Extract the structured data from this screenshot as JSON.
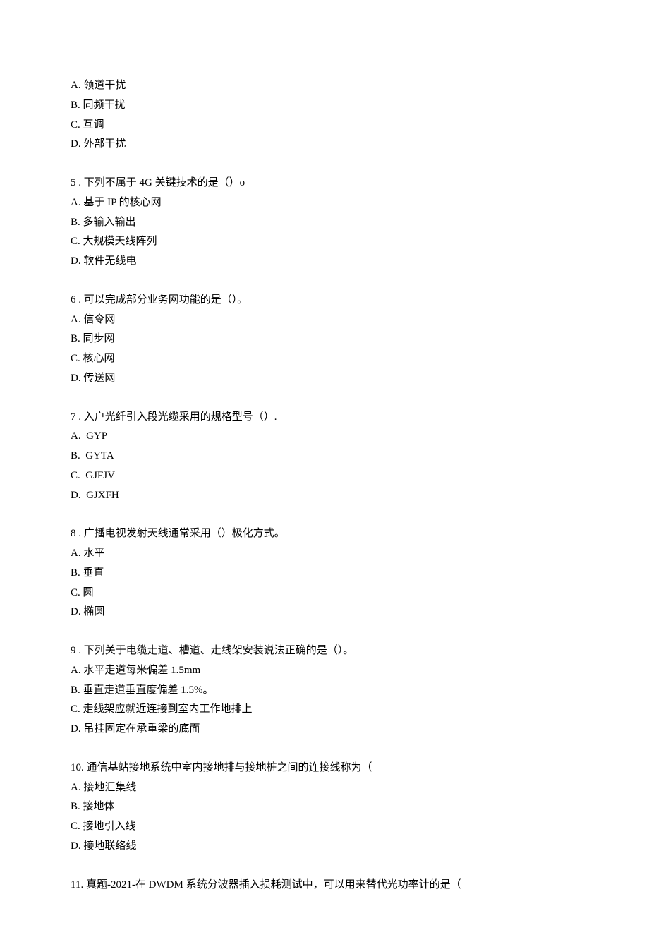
{
  "q4": {
    "options": {
      "a": "A. 领道干扰",
      "b": "B. 同频干扰",
      "c": "C. 互调",
      "d": "D. 外部干扰"
    }
  },
  "q5": {
    "stem": "5 . 下列不属于 4G 关键技术的是（）o",
    "options": {
      "a": "A. 基于 IP 的核心网",
      "b": "B. 多输入输出",
      "c": "C. 大规模天线阵列",
      "d": "D. 软件无线电"
    }
  },
  "q6": {
    "stem": "6 . 可以完成部分业务网功能的是（）。",
    "options": {
      "a": "A. 信令网",
      "b": "B. 同步网",
      "c": "C. 核心网",
      "d": "D. 传送网"
    }
  },
  "q7": {
    "stem": "7 . 入户光纤引入段光缆采用的规格型号（）.",
    "options": {
      "a": "A.  GYP",
      "b": "B.  GYTA",
      "c": "C.  GJFJV",
      "d": "D.  GJXFH"
    }
  },
  "q8": {
    "stem": "8 . 广播电视发射天线通常采用（）极化方式。",
    "options": {
      "a": "A. 水平",
      "b": "B. 垂直",
      "c": "C. 圆",
      "d": "D. 椭圆"
    }
  },
  "q9": {
    "stem": "9 . 下列关于电缆走道、槽道、走线架安装说法正确的是（）。",
    "options": {
      "a": "A. 水平走道每米偏差 1.5mm",
      "b": "B. 垂直走道垂直度偏差 1.5%。",
      "c": "C. 走线架应就近连接到室内工作地排上",
      "d": "D. 吊挂固定在承重梁的底面"
    }
  },
  "q10": {
    "stem": "10. 通信基站接地系统中室内接地排与接地桩之间的连接线称为（",
    "options": {
      "a": "A. 接地汇集线",
      "b": "B. 接地体",
      "c": "C. 接地引入线",
      "d": "D. 接地联络线"
    }
  },
  "q11": {
    "stem": "11. 真题-2021-在 DWDM 系统分波器插入损耗测试中，可以用来替代光功率计的是（"
  }
}
